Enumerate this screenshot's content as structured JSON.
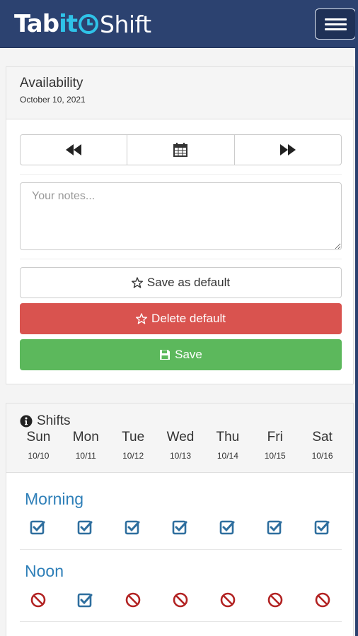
{
  "brand": {
    "part1": "Tab",
    "part2": "it",
    "part3": "Shift"
  },
  "availability": {
    "title": "Availability",
    "date": "October 10, 2021",
    "notes_placeholder": "Your notes...",
    "notes_value": "",
    "save_default_label": "Save as default",
    "delete_default_label": "Delete default",
    "save_label": "Save"
  },
  "shifts": {
    "title": "Shifts",
    "days": [
      {
        "name": "Sun",
        "date": "10/10"
      },
      {
        "name": "Mon",
        "date": "10/11"
      },
      {
        "name": "Tue",
        "date": "10/12"
      },
      {
        "name": "Wed",
        "date": "10/13"
      },
      {
        "name": "Thu",
        "date": "10/14"
      },
      {
        "name": "Fri",
        "date": "10/15"
      },
      {
        "name": "Sat",
        "date": "10/16"
      }
    ],
    "rows": [
      {
        "label": "Morning",
        "status": [
          "available",
          "available",
          "available",
          "available",
          "available",
          "available",
          "available"
        ]
      },
      {
        "label": "Noon",
        "status": [
          "unavailable",
          "available",
          "unavailable",
          "unavailable",
          "unavailable",
          "unavailable",
          "unavailable"
        ]
      }
    ]
  },
  "colors": {
    "navbar": "#2c4270",
    "brand_accent": "#2fc3e8",
    "danger": "#d9534f",
    "success": "#5cb85c",
    "shift_label": "#2e7fb8",
    "check": "#2e6e9e",
    "ban": "#b22222"
  },
  "icons": {
    "prev": "fast-backward-icon",
    "calendar": "calendar-icon",
    "next": "fast-forward-icon",
    "star": "star-icon",
    "save": "floppy-disk-icon",
    "info": "info-circle-icon",
    "available": "check-square-icon",
    "unavailable": "ban-icon"
  }
}
